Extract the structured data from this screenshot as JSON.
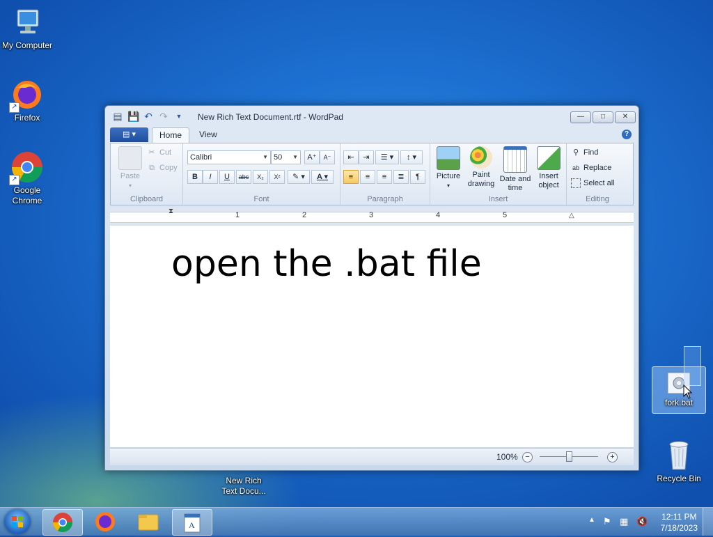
{
  "desktop": {
    "icons": [
      {
        "label": "My Computer"
      },
      {
        "label": "Firefox"
      },
      {
        "label": "Google Chrome"
      },
      {
        "label": "fork.bat"
      },
      {
        "label": "Recycle Bin"
      },
      {
        "label": "New Rich Text Docu..."
      }
    ]
  },
  "window": {
    "title": "New Rich Text Document.rtf - WordPad",
    "tabs": [
      {
        "label": "Home"
      },
      {
        "label": "View"
      }
    ],
    "help": "?",
    "clipboard": {
      "paste": "Paste",
      "cut": "Cut",
      "copy": "Copy",
      "label": "Clipboard"
    },
    "font": {
      "family": "Calibri",
      "size": "50",
      "label": "Font",
      "bold": "B",
      "italic": "I",
      "underline": "U",
      "strike": "abc",
      "subscript": "X₂",
      "superscript": "X²",
      "grow": "A",
      "shrink": "A",
      "color": "A"
    },
    "paragraph": {
      "label": "Paragraph"
    },
    "insert": {
      "picture": "Picture",
      "paint": "Paint drawing",
      "datetime": "Date and time",
      "object": "Insert object",
      "label": "Insert"
    },
    "editing": {
      "find": "Find",
      "replace": "Replace",
      "select_all": "Select all",
      "label": "Editing"
    },
    "ruler": [
      "1",
      "2",
      "3",
      "4",
      "5"
    ],
    "document_text": "open the .bat file",
    "zoom": "100%"
  },
  "taskbar": {
    "time": "12:11 PM",
    "date": "7/18/2023"
  },
  "colors": {
    "accent": "#1d5fb8",
    "window_frame": "#dfe9f5"
  }
}
